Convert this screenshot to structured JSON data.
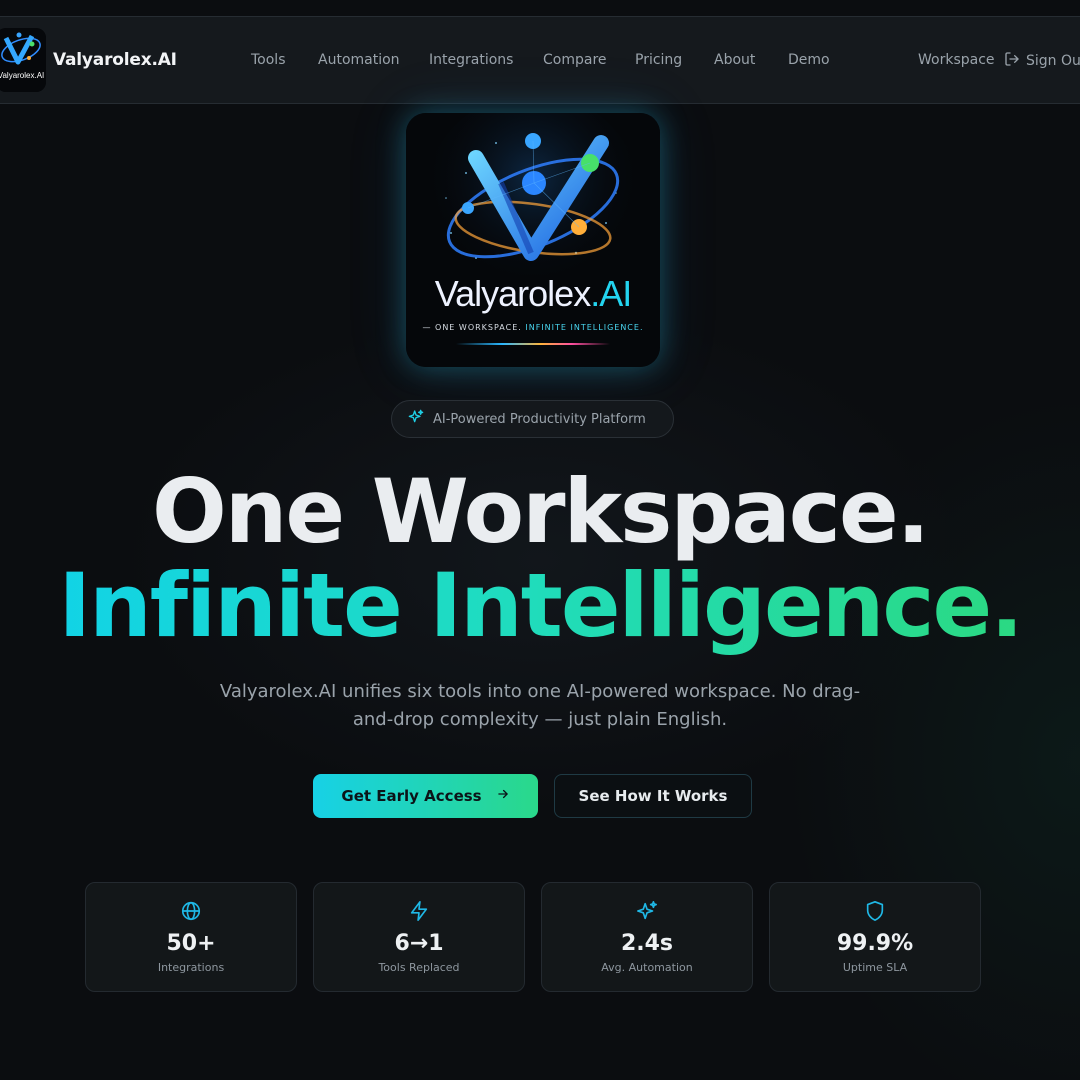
{
  "brand": {
    "name": "Valyarolex.AI",
    "logo_wordmark": "Valyarolex",
    "logo_wordmark_suffix": ".AI",
    "logo_tagline_prefix": "— ONE WORKSPACE. ",
    "logo_tagline_highlight": "INFINITE INTELLIGENCE."
  },
  "nav": {
    "links": [
      "Tools",
      "Automation",
      "Integrations",
      "Compare",
      "Pricing",
      "About",
      "Demo"
    ],
    "workspace": "Workspace",
    "sign_out": "Sign Out"
  },
  "hero": {
    "badge": "AI-Powered Productivity Platform",
    "headline_1": "One Workspace.",
    "headline_2": "Infinite Intelligence.",
    "subtitle": "Valyarolex.AI unifies six tools into one AI-powered workspace. No drag-and-drop complexity — just plain English.",
    "cta_primary": "Get Early Access",
    "cta_secondary": "See How It Works"
  },
  "stats": [
    {
      "icon": "globe-icon",
      "value": "50+",
      "label": "Integrations"
    },
    {
      "icon": "lightning-icon",
      "value": "6→1",
      "label": "Tools Replaced"
    },
    {
      "icon": "sparkles-icon",
      "value": "2.4s",
      "label": "Avg. Automation"
    },
    {
      "icon": "shield-icon",
      "value": "99.9%",
      "label": "Uptime SLA"
    }
  ],
  "colors": {
    "background": "#0b0d10",
    "accent_cyan": "#17d1e6",
    "accent_green": "#2ad88a",
    "muted_text": "#9aa3ab"
  }
}
